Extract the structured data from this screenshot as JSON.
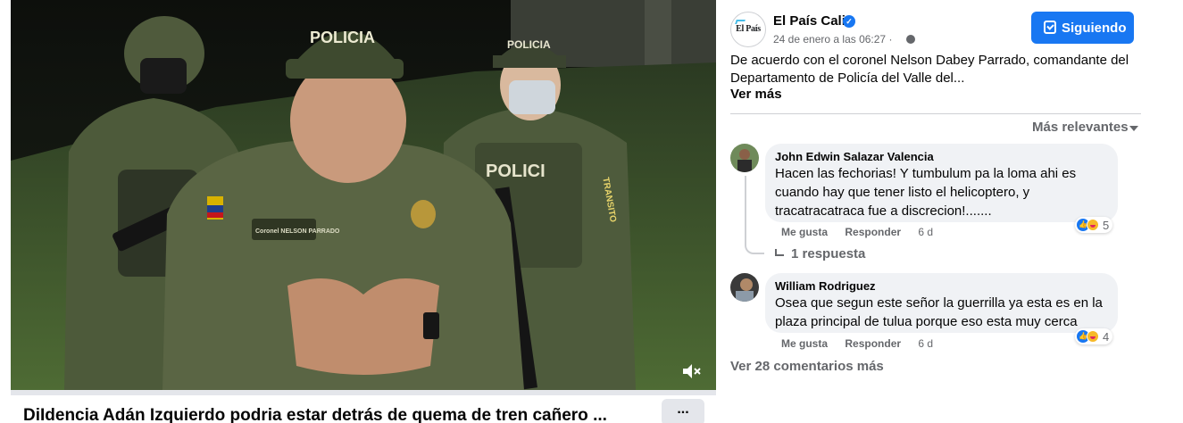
{
  "post": {
    "title": "DiIdencia Adán Izquierdo podria estar detrás de quema de tren cañero ...",
    "more_label": "...",
    "page_name": "El País Cali",
    "page_avatar_text": "El País",
    "date": "24 de enero a las 06:27",
    "meta_separator": "·",
    "follow_label": "Siguiendo",
    "text": "De acuerdo con el coronel Nelson Dabey Parrado, comandante del Departamento de Policía del Valle del...",
    "see_more": "Ver más",
    "verified_mark": "✓"
  },
  "video": {
    "cap_text_center": "POLICIA",
    "cap_text_right": "POLICIA",
    "vest_text": "POLICI",
    "name_tag": "Coronel NELSON PARRADO",
    "sleeve_text": "TRANSITO"
  },
  "comments": {
    "sort_label": "Más relevantes",
    "items": [
      {
        "author": "John Edwin Salazar Valencia",
        "text_lines": [
          "Hacen las fechorias! Y tumbulum pa la loma ahi es",
          "cuando hay que tener listo el helicoptero, y",
          "tracatracatraca fue a discrecion!......."
        ],
        "like": "Me gusta",
        "reply": "Responder",
        "time": "6 d",
        "reaction_count": "5"
      },
      {
        "author": "William Rodriguez",
        "text_lines": [
          "Osea que segun este señor la guerrilla ya esta es en la",
          "plaza principal de tulua porque eso esta muy cerca"
        ],
        "like": "Me gusta",
        "reply": "Responder",
        "time": "6 d",
        "reaction_count": "4"
      }
    ],
    "replies_label": "1 respuesta",
    "more_comments": "Ver 28 comentarios más"
  },
  "colors": {
    "accent": "#1877f2",
    "secondary_text": "#65676b",
    "bubble": "#f0f2f5"
  },
  "icons": [
    "mute-icon",
    "verified-icon",
    "globe-icon",
    "follow-check-icon",
    "sort-caret-icon",
    "reply-arrow-icon",
    "like-reaction-icon",
    "haha-reaction-icon"
  ]
}
